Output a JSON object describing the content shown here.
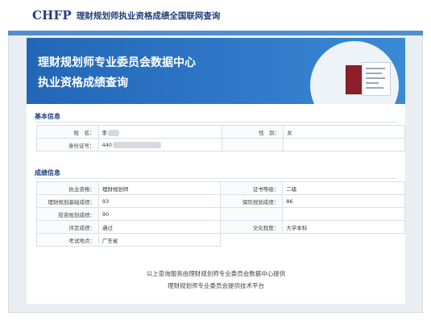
{
  "brand": {
    "logo": "CHFP",
    "tagline": "理财规划师执业资格成绩全国联网查询"
  },
  "banner": {
    "line1": "理财规划师专业委员会数据中心",
    "line2": "执业资格成绩查询"
  },
  "colors": {
    "brand_navy": "#1f3f7a",
    "banner_blue": "#2e78c7",
    "strip_blue": "#4f8fd1",
    "certificate_red": "#8e1f2a"
  },
  "basic": {
    "title": "基本信息",
    "rows": [
      {
        "l1": "姓　名：",
        "v1": "李",
        "l2": "性　别：",
        "v2": "女"
      },
      {
        "l1": "身份证号：",
        "v1": "440",
        "l2": "",
        "v2": ""
      }
    ]
  },
  "scores": {
    "title": "成绩信息",
    "rows": [
      {
        "l1": "执业资格：",
        "v1": "理财规划师",
        "l2": "证书等级：",
        "v2": "二级"
      },
      {
        "l1": "理财规划基础成绩：",
        "v1": "93",
        "l2": "保险规划成绩：",
        "v2": "86"
      },
      {
        "l1": "投资规划成绩：",
        "v1": "90",
        "l2": "",
        "v2": ""
      },
      {
        "l1": "评定成绩：",
        "v1": "通过",
        "l2": "文化程度：",
        "v2": "大学本科"
      },
      {
        "l1": "考试地点：",
        "v1": "广东省",
        "l2": "",
        "v2": ""
      }
    ]
  },
  "footer": {
    "line1": "以上查询服务由理财规划师专业委员会数据中心提供",
    "line2": "理财规划师专业委员会提供技术平台"
  }
}
